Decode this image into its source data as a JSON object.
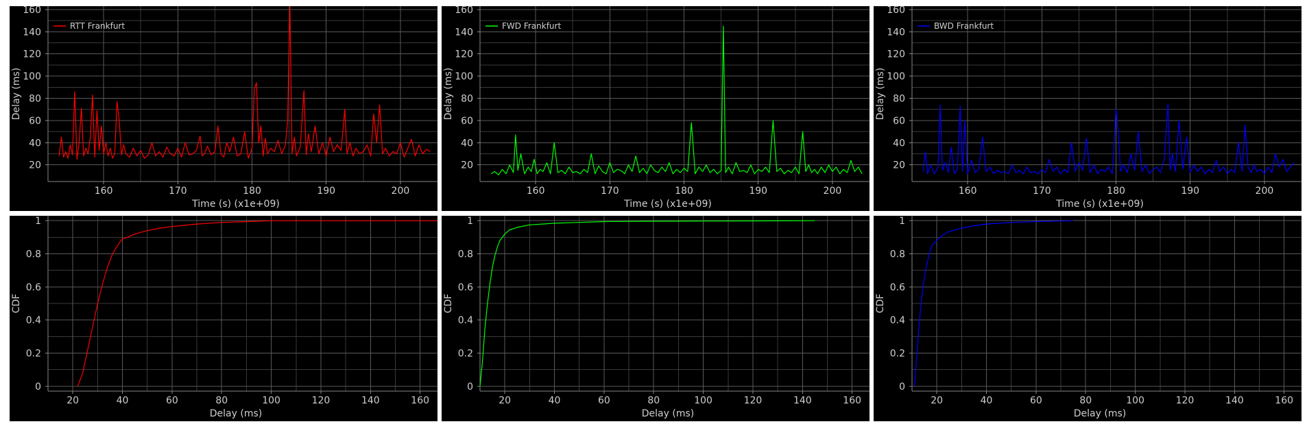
{
  "colors": {
    "rtt": "#ff0000",
    "fwd": "#00ff00",
    "bwd": "#0000ff",
    "background": "#000000"
  },
  "chart_data": [
    {
      "type": "line",
      "legend": [
        "RTT Frankfurt"
      ],
      "legend_position": "top-left",
      "xlabel": "Time (s) (x1e+09)",
      "ylabel": "Delay (ms)",
      "xlim": [
        152.5,
        205
      ],
      "ylim": [
        5,
        163
      ],
      "grid": true,
      "xticks": [
        160,
        170,
        180,
        190,
        200
      ],
      "yticks": [
        20,
        40,
        60,
        80,
        100,
        120,
        140,
        160
      ],
      "series": [
        {
          "name": "RTT Frankfurt",
          "color": "#ff0000",
          "x": [
            154,
            154.3,
            154.6,
            154.9,
            155.2,
            155.5,
            155.8,
            156.1,
            156.4,
            156.7,
            157.0,
            157.3,
            157.6,
            157.9,
            158.2,
            158.5,
            158.8,
            159.1,
            159.4,
            159.7,
            160.0,
            160.3,
            160.6,
            160.9,
            161.2,
            161.5,
            161.8,
            162.1,
            162.4,
            162.7,
            163.0,
            163.5,
            164.0,
            164.5,
            165.0,
            165.5,
            166.0,
            166.5,
            167.0,
            167.5,
            168.0,
            168.5,
            169.0,
            169.5,
            170.0,
            170.5,
            171.0,
            171.5,
            172.0,
            172.5,
            173.0,
            173.3,
            173.6,
            174.0,
            174.5,
            175.0,
            175.4,
            175.8,
            176.2,
            176.6,
            177.0,
            177.5,
            178.0,
            178.5,
            179.0,
            179.5,
            180.0,
            180.3,
            180.6,
            180.9,
            181.2,
            181.5,
            181.8,
            182.1,
            182.5,
            183.0,
            183.5,
            184.0,
            184.5,
            184.8,
            185.1,
            185.4,
            185.7,
            186.0,
            186.5,
            187.0,
            187.3,
            187.6,
            188.0,
            188.5,
            189.0,
            189.5,
            190.0,
            190.5,
            191.0,
            191.5,
            192.0,
            192.5,
            192.8,
            193.2,
            193.6,
            194.0,
            194.5,
            195.0,
            195.5,
            196.0,
            196.4,
            196.8,
            197.2,
            197.6,
            198.0,
            198.5,
            199.0,
            199.5,
            200.0,
            200.5,
            201.0,
            201.5,
            202.0,
            202.5,
            203.0,
            203.5,
            204.0
          ],
          "y": [
            28,
            45,
            27,
            32,
            26,
            38,
            29,
            86,
            25,
            40,
            71,
            28,
            35,
            30,
            45,
            83,
            27,
            69,
            33,
            55,
            30,
            40,
            28,
            35,
            26,
            30,
            77,
            60,
            29,
            38,
            30,
            27,
            35,
            28,
            33,
            26,
            29,
            40,
            28,
            32,
            27,
            36,
            30,
            28,
            35,
            27,
            40,
            29,
            30,
            33,
            46,
            28,
            30,
            37,
            29,
            32,
            55,
            30,
            27,
            40,
            32,
            45,
            28,
            30,
            50,
            26,
            35,
            88,
            94,
            40,
            55,
            28,
            44,
            30,
            35,
            32,
            42,
            30,
            38,
            60,
            165,
            30,
            45,
            28,
            36,
            87,
            29,
            48,
            32,
            55,
            30,
            40,
            28,
            45,
            32,
            38,
            33,
            70,
            30,
            40,
            28,
            35,
            30,
            32,
            38,
            28,
            66,
            40,
            74,
            30,
            35,
            28,
            32,
            30,
            40,
            27,
            35,
            43,
            28,
            38,
            30,
            34,
            32
          ]
        }
      ]
    },
    {
      "type": "line",
      "legend": [
        "FWD Frankfurt"
      ],
      "legend_position": "top-left",
      "xlabel": "Time (s) (x1e+09)",
      "ylabel": "Delay (ms)",
      "xlim": [
        152.5,
        205
      ],
      "ylim": [
        5,
        163
      ],
      "grid": true,
      "xticks": [
        160,
        170,
        180,
        190,
        200
      ],
      "yticks": [
        20,
        40,
        60,
        80,
        100,
        120,
        140,
        160
      ],
      "series": [
        {
          "name": "FWD Frankfurt",
          "color": "#00ff00",
          "x": [
            154,
            154.5,
            155.0,
            155.5,
            156.0,
            156.5,
            157.0,
            157.3,
            157.6,
            158.0,
            158.5,
            159.0,
            159.4,
            159.8,
            160.2,
            160.6,
            161.0,
            161.5,
            162.0,
            162.5,
            163.0,
            163.5,
            164.0,
            164.5,
            165.0,
            165.5,
            166.0,
            166.5,
            167.0,
            167.5,
            168.0,
            168.5,
            169.0,
            169.5,
            170.0,
            170.5,
            171.0,
            171.5,
            172.0,
            172.5,
            173.0,
            173.5,
            174.0,
            174.5,
            175.0,
            175.5,
            176.0,
            176.5,
            177.0,
            177.5,
            178.0,
            178.5,
            179.0,
            179.5,
            180.0,
            180.5,
            181.0,
            181.5,
            182.0,
            182.5,
            183.0,
            183.5,
            184.0,
            184.5,
            185.0,
            185.3,
            185.6,
            186.0,
            186.5,
            187.0,
            187.5,
            188.0,
            188.5,
            189.0,
            189.5,
            190.0,
            190.5,
            191.0,
            191.5,
            192.0,
            192.5,
            193.0,
            193.5,
            194.0,
            194.5,
            195.0,
            195.5,
            196.0,
            196.4,
            196.8,
            197.2,
            197.6,
            198.0,
            198.5,
            199.0,
            199.5,
            200.0,
            200.5,
            201.0,
            201.5,
            202.0,
            202.5,
            203.0,
            203.5,
            204.0
          ],
          "y": [
            12,
            14,
            11,
            16,
            12,
            20,
            13,
            47,
            15,
            30,
            12,
            18,
            14,
            25,
            12,
            16,
            14,
            22,
            12,
            40,
            13,
            15,
            12,
            18,
            13,
            14,
            12,
            16,
            13,
            30,
            12,
            19,
            14,
            12,
            22,
            13,
            16,
            15,
            12,
            20,
            14,
            28,
            13,
            17,
            12,
            20,
            15,
            13,
            18,
            14,
            22,
            12,
            16,
            13,
            17,
            14,
            58,
            12,
            18,
            14,
            20,
            13,
            16,
            12,
            15,
            145,
            13,
            18,
            12,
            22,
            14,
            15,
            13,
            20,
            12,
            16,
            14,
            18,
            13,
            60,
            14,
            17,
            12,
            15,
            13,
            18,
            12,
            50,
            14,
            20,
            13,
            16,
            12,
            18,
            13,
            20,
            14,
            18,
            12,
            16,
            13,
            24,
            14,
            18,
            12
          ]
        }
      ]
    },
    {
      "type": "line",
      "legend": [
        "BWD Frankfurt"
      ],
      "legend_position": "top-left",
      "xlabel": "Time (s) (x1e+09)",
      "ylabel": "Delay (ms)",
      "xlim": [
        152.5,
        205
      ],
      "ylim": [
        5,
        163
      ],
      "grid": true,
      "xticks": [
        160,
        170,
        180,
        190,
        200
      ],
      "yticks": [
        20,
        40,
        60,
        80,
        100,
        120,
        140,
        160
      ],
      "series": [
        {
          "name": "BWD Frankfurt",
          "color": "#0000ff",
          "x": [
            154,
            154.3,
            154.6,
            155.0,
            155.5,
            156.0,
            156.3,
            156.6,
            157.0,
            157.4,
            157.8,
            158.2,
            158.6,
            159.0,
            159.3,
            159.6,
            160.0,
            160.5,
            161.0,
            161.5,
            162.0,
            162.5,
            163.0,
            163.5,
            164.0,
            164.5,
            165.0,
            165.5,
            166.0,
            166.5,
            167.0,
            167.5,
            168.0,
            168.5,
            169.0,
            169.5,
            170.0,
            170.5,
            171.0,
            171.5,
            172.0,
            172.5,
            173.0,
            173.5,
            174.0,
            174.5,
            175.0,
            175.5,
            176.0,
            176.5,
            177.0,
            177.5,
            178.0,
            178.5,
            179.0,
            179.5,
            180.0,
            180.3,
            180.6,
            181.0,
            181.5,
            182.0,
            182.5,
            183.0,
            183.5,
            184.0,
            184.5,
            185.0,
            185.5,
            186.0,
            186.5,
            187.0,
            187.3,
            187.6,
            188.0,
            188.5,
            189.0,
            189.5,
            190.0,
            190.5,
            191.0,
            191.5,
            192.0,
            192.5,
            193.0,
            193.5,
            194.0,
            194.5,
            195.0,
            195.5,
            196.0,
            196.5,
            197.0,
            197.4,
            197.8,
            198.2,
            198.6,
            199.0,
            199.5,
            200.0,
            200.5,
            201.0,
            201.5,
            202.0,
            202.5,
            203.0,
            203.5,
            204.0
          ],
          "y": [
            14,
            32,
            12,
            20,
            12,
            18,
            74,
            15,
            22,
            13,
            36,
            12,
            16,
            73,
            14,
            60,
            12,
            24,
            13,
            16,
            45,
            14,
            18,
            12,
            15,
            13,
            14,
            12,
            20,
            13,
            15,
            12,
            18,
            13,
            14,
            12,
            16,
            13,
            25,
            14,
            18,
            12,
            16,
            13,
            40,
            14,
            22,
            15,
            44,
            13,
            20,
            12,
            16,
            14,
            18,
            12,
            70,
            50,
            14,
            20,
            13,
            30,
            15,
            50,
            14,
            20,
            12,
            16,
            18,
            13,
            25,
            75,
            15,
            30,
            14,
            60,
            16,
            45,
            13,
            20,
            14,
            18,
            12,
            16,
            13,
            24,
            14,
            18,
            12,
            16,
            13,
            40,
            14,
            56,
            18,
            13,
            20,
            14,
            16,
            12,
            18,
            13,
            30,
            18,
            25,
            14,
            18,
            22
          ]
        }
      ]
    },
    {
      "type": "line",
      "xlabel": "Delay (ms)",
      "ylabel": "CDF",
      "xlim": [
        10,
        167
      ],
      "ylim": [
        -0.03,
        1.03
      ],
      "grid": true,
      "xticks": [
        20,
        40,
        60,
        80,
        100,
        120,
        140,
        160
      ],
      "yticks": [
        0,
        0.2,
        0.4,
        0.6,
        0.8,
        1
      ],
      "series": [
        {
          "color": "#ff0000",
          "x": [
            22,
            24,
            26,
            28,
            30,
            32,
            34,
            36,
            38,
            40,
            42,
            45,
            50,
            55,
            60,
            70,
            80,
            90,
            100,
            120,
            140,
            167
          ],
          "y": [
            0,
            0.08,
            0.22,
            0.36,
            0.5,
            0.62,
            0.72,
            0.8,
            0.85,
            0.89,
            0.9,
            0.92,
            0.94,
            0.955,
            0.965,
            0.98,
            0.99,
            0.995,
            1,
            1,
            1,
            1
          ]
        }
      ]
    },
    {
      "type": "line",
      "xlabel": "Delay (ms)",
      "ylabel": "CDF",
      "xlim": [
        10,
        167
      ],
      "ylim": [
        -0.03,
        1.03
      ],
      "grid": true,
      "xticks": [
        20,
        40,
        60,
        80,
        100,
        120,
        140,
        160
      ],
      "yticks": [
        0,
        0.2,
        0.4,
        0.6,
        0.8,
        1
      ],
      "series": [
        {
          "color": "#00ff00",
          "x": [
            10,
            11,
            12,
            13,
            14,
            15,
            16,
            17,
            18,
            20,
            22,
            25,
            30,
            35,
            40,
            50,
            60,
            80,
            100,
            120,
            145
          ],
          "y": [
            0,
            0.15,
            0.35,
            0.5,
            0.62,
            0.72,
            0.79,
            0.84,
            0.88,
            0.92,
            0.945,
            0.96,
            0.975,
            0.98,
            0.985,
            0.99,
            0.995,
            0.997,
            0.998,
            0.999,
            1
          ]
        }
      ]
    },
    {
      "type": "line",
      "xlabel": "Delay (ms)",
      "ylabel": "CDF",
      "xlim": [
        10,
        167
      ],
      "ylim": [
        -0.03,
        1.03
      ],
      "grid": true,
      "xticks": [
        20,
        40,
        60,
        80,
        100,
        120,
        140,
        160
      ],
      "yticks": [
        0,
        0.2,
        0.4,
        0.6,
        0.8,
        1
      ],
      "series": [
        {
          "color": "#0000ff",
          "x": [
            11,
            12,
            13,
            14,
            15,
            16,
            17,
            18,
            20,
            22,
            25,
            30,
            35,
            40,
            50,
            60,
            75
          ],
          "y": [
            0,
            0.2,
            0.4,
            0.55,
            0.66,
            0.74,
            0.8,
            0.85,
            0.88,
            0.91,
            0.935,
            0.955,
            0.97,
            0.98,
            0.99,
            0.995,
            1
          ]
        }
      ]
    }
  ]
}
